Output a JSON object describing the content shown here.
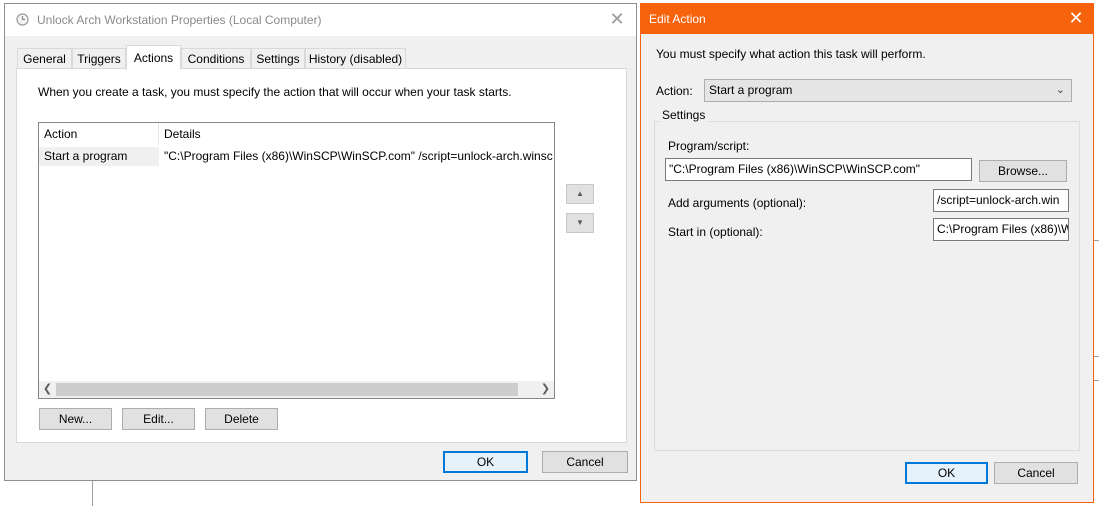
{
  "properties_window": {
    "title": "Unlock Arch Workstation Properties (Local Computer)",
    "close_glyph": "✕",
    "tabs": [
      {
        "label": "General"
      },
      {
        "label": "Triggers"
      },
      {
        "label": "Actions"
      },
      {
        "label": "Conditions"
      },
      {
        "label": "Settings"
      },
      {
        "label": "History (disabled)"
      }
    ],
    "active_tab": "Actions",
    "instruction": "When you create a task, you must specify the action that will occur when your task starts.",
    "list": {
      "columns": [
        "Action",
        "Details"
      ],
      "rows": [
        {
          "action": "Start a program",
          "details": "\"C:\\Program Files (x86)\\WinSCP\\WinSCP.com\" /script=unlock-arch.winsc"
        }
      ]
    },
    "buttons": {
      "new": "New...",
      "edit": "Edit...",
      "delete": "Delete",
      "ok": "OK",
      "cancel": "Cancel"
    },
    "icons": {
      "title": "clock-icon",
      "move_up": "triangle-up-icon",
      "move_down": "triangle-down-icon"
    }
  },
  "edit_action": {
    "title": "Edit Action",
    "close_glyph": "✕",
    "prompt": "You must specify what action this task will perform.",
    "action_label": "Action:",
    "action_value": "Start a program",
    "settings_group": "Settings",
    "program_label": "Program/script:",
    "program_value": "\"C:\\Program Files (x86)\\WinSCP\\WinSCP.com\"",
    "browse_label": "Browse...",
    "args_label": "Add arguments (optional):",
    "args_value": "/script=unlock-arch.win",
    "startin_label": "Start in (optional):",
    "startin_value": "C:\\Program Files (x86)\\W",
    "ok": "OK",
    "cancel": "Cancel"
  },
  "colors": {
    "accent": "#f7630c",
    "focus": "#0078d7"
  }
}
